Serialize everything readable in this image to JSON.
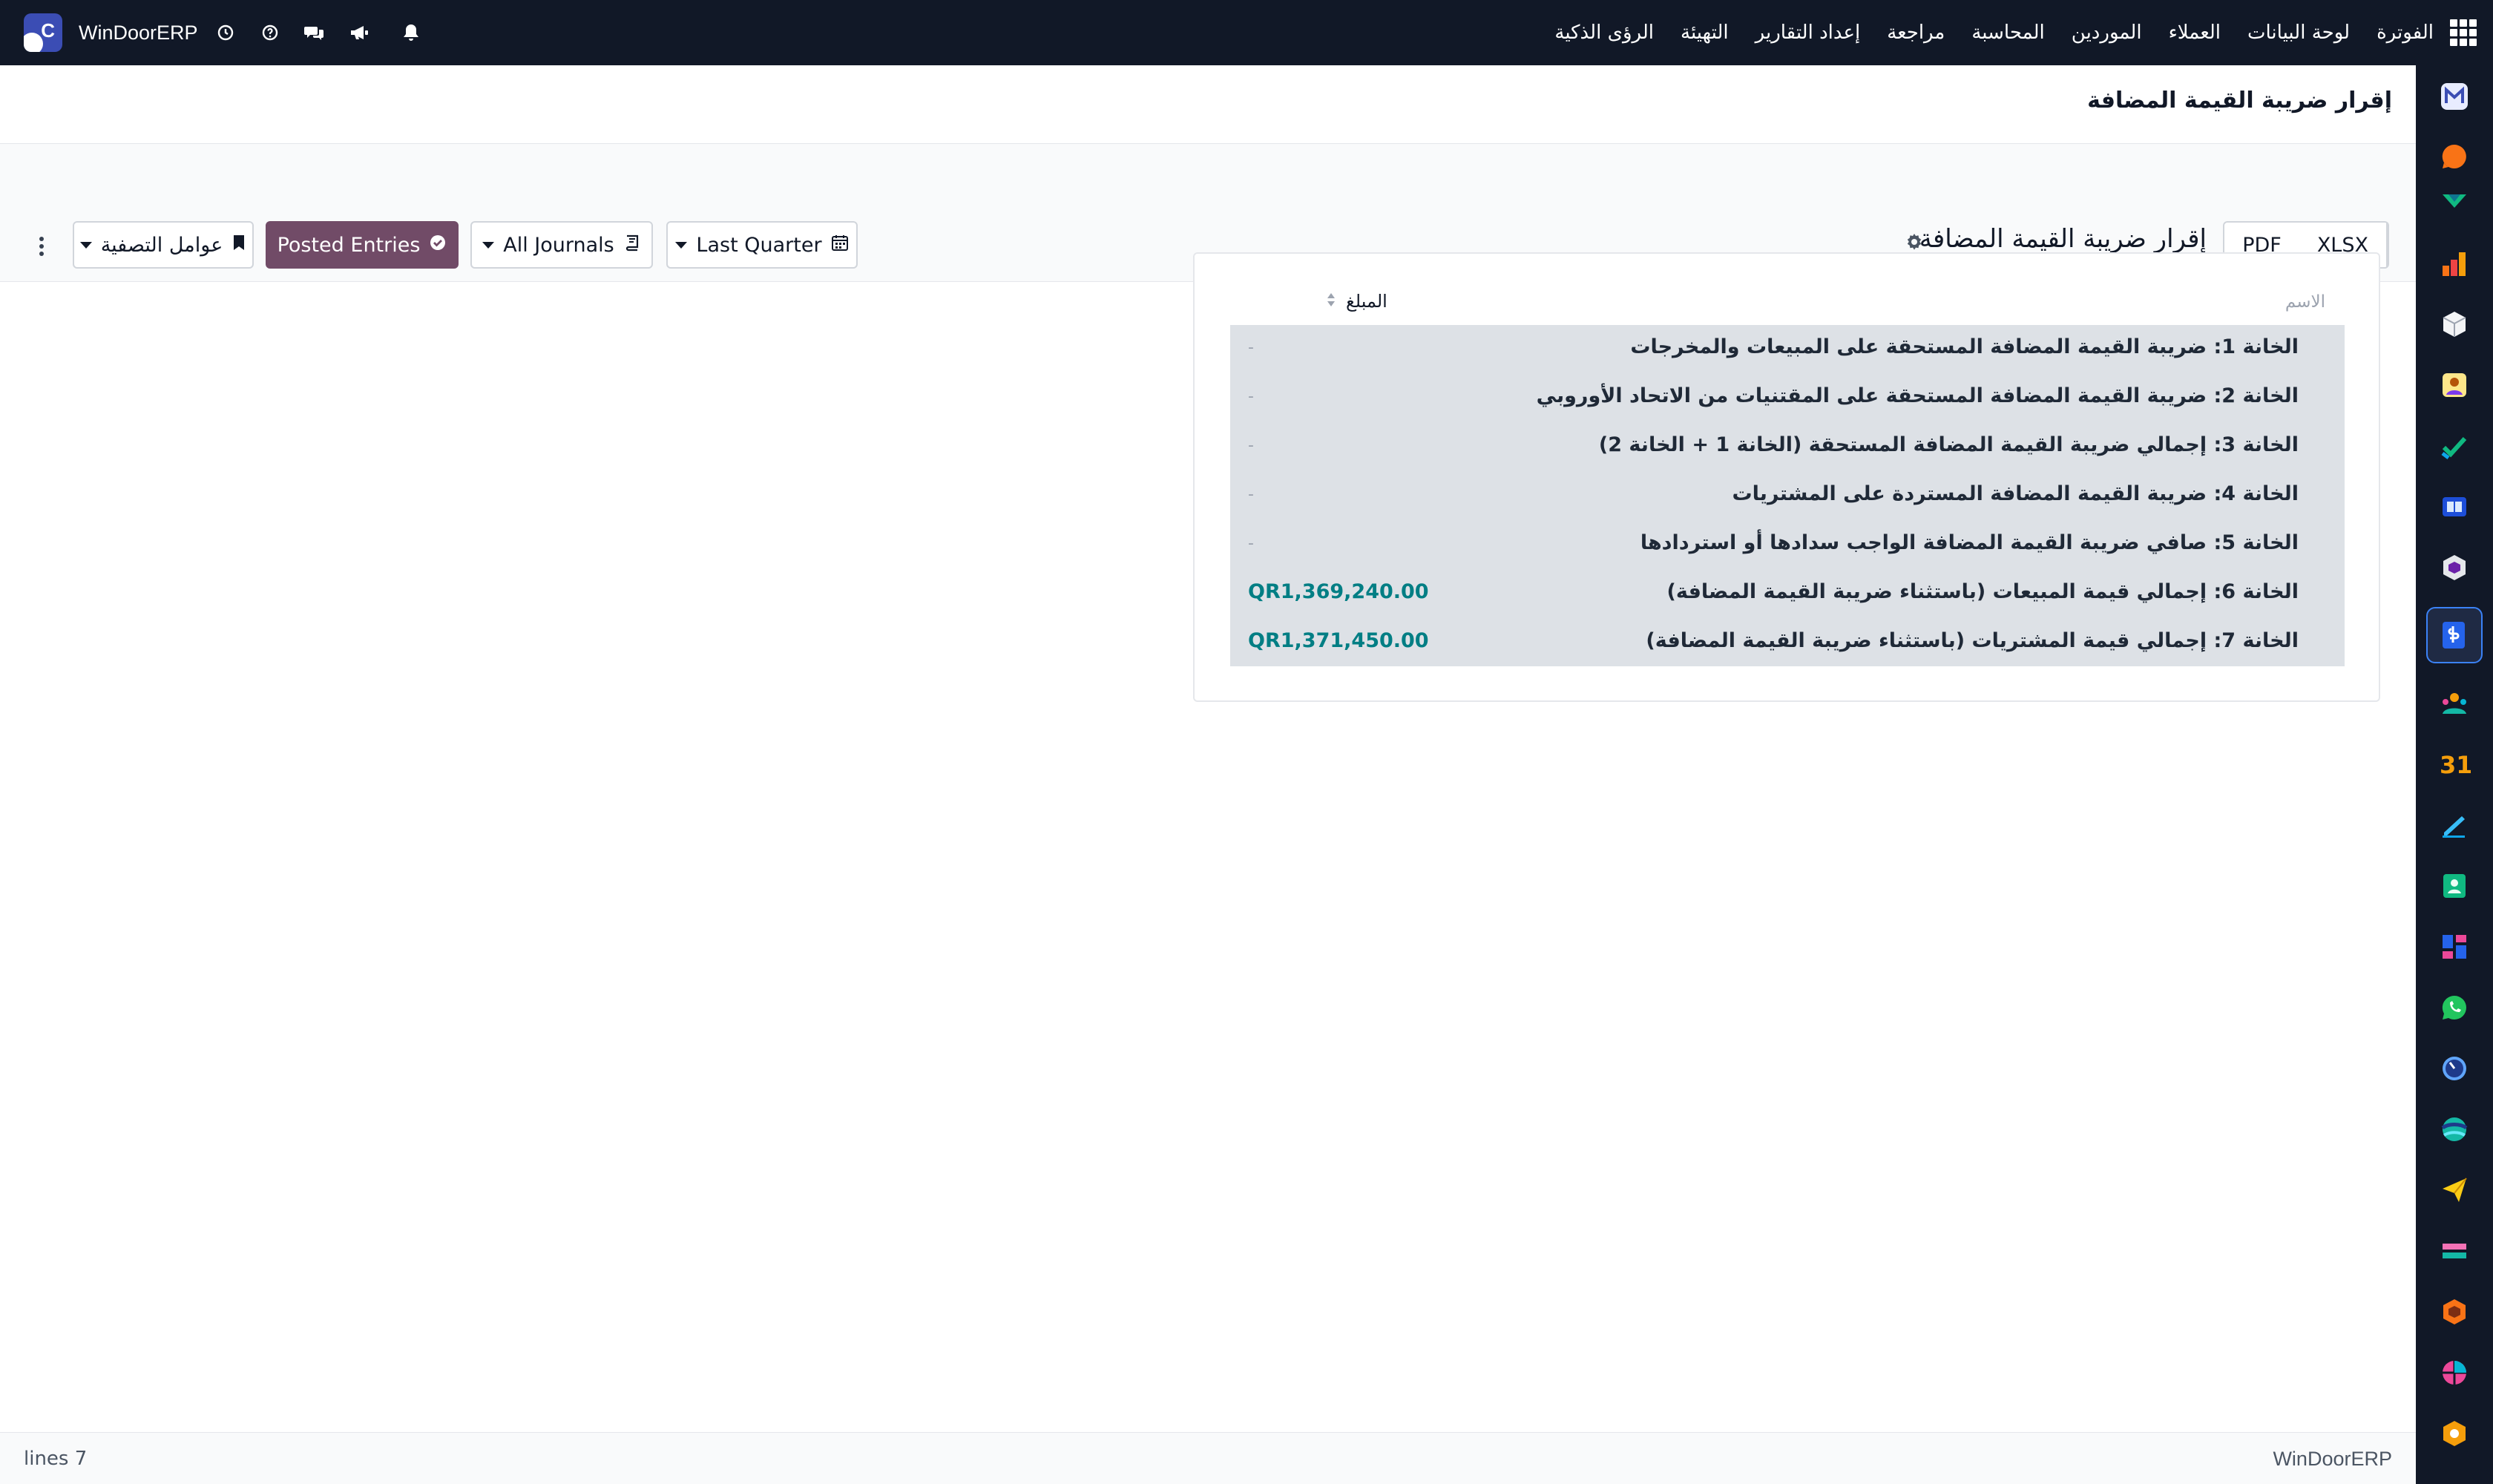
{
  "app": {
    "brand_name": "WinDoorERP",
    "nav_items": [
      "الفوترة",
      "لوحة البيانات",
      "العملاء",
      "الموردين",
      "المحاسبة",
      "مراجعة",
      "إعداد التقارير",
      "التهيئة",
      "الرؤى الذكية"
    ],
    "system_icons": [
      "clock-icon",
      "help-icon",
      "chat-icon",
      "megaphone-icon",
      "bell-icon"
    ],
    "apps_icon": "grid-icon"
  },
  "page": {
    "breadcrumb": "إقرار ضريبة القيمة المضافة"
  },
  "controls": {
    "export_pdf": "PDF",
    "export_xlsx": "XLSX",
    "report_title": "إقرار ضريبة القيمة المضافة",
    "date_filter": "Last Quarter",
    "journals_filter": "All Journals",
    "posted_entries": "Posted Entries",
    "filter_factors": "عوامل التصفية"
  },
  "report": {
    "col_name": "الاسم",
    "col_amount": "المبلغ",
    "empty_value": "-",
    "rows": [
      {
        "label": "الخانة 1: ضريبة القيمة المضافة المستحقة على المبيعات والمخرجات",
        "value": "-"
      },
      {
        "label": "الخانة 2: ضريبة القيمة المضافة المستحقة على المقتنيات من الاتحاد الأوروبي",
        "value": "-"
      },
      {
        "label": "الخانة 3: إجمالي ضريبة القيمة المضافة المستحقة (الخانة 1 + الخانة 2)",
        "value": "-"
      },
      {
        "label": "الخانة 4: ضريبة القيمة المضافة المستردة على المشتريات",
        "value": "-"
      },
      {
        "label": "الخانة 5: صافي ضريبة القيمة المضافة الواجب سدادها أو استردادها",
        "value": "-"
      },
      {
        "label": "الخانة 6: إجمالي قيمة المبيعات (باستثناء ضريبة القيمة المضافة)",
        "value": "QR1,369,240.00"
      },
      {
        "label": "الخانة 7: إجمالي قيمة المشتريات (باستثناء ضريبة القيمة المضافة)",
        "value": "QR1,371,450.00"
      }
    ]
  },
  "footer": {
    "lines_count": "lines 7",
    "brand": "WinDoorERP"
  },
  "colors": {
    "navbar": "#111827",
    "primary": "#714b67",
    "amount": "#017e84",
    "row_bg": "#dde1e6"
  }
}
